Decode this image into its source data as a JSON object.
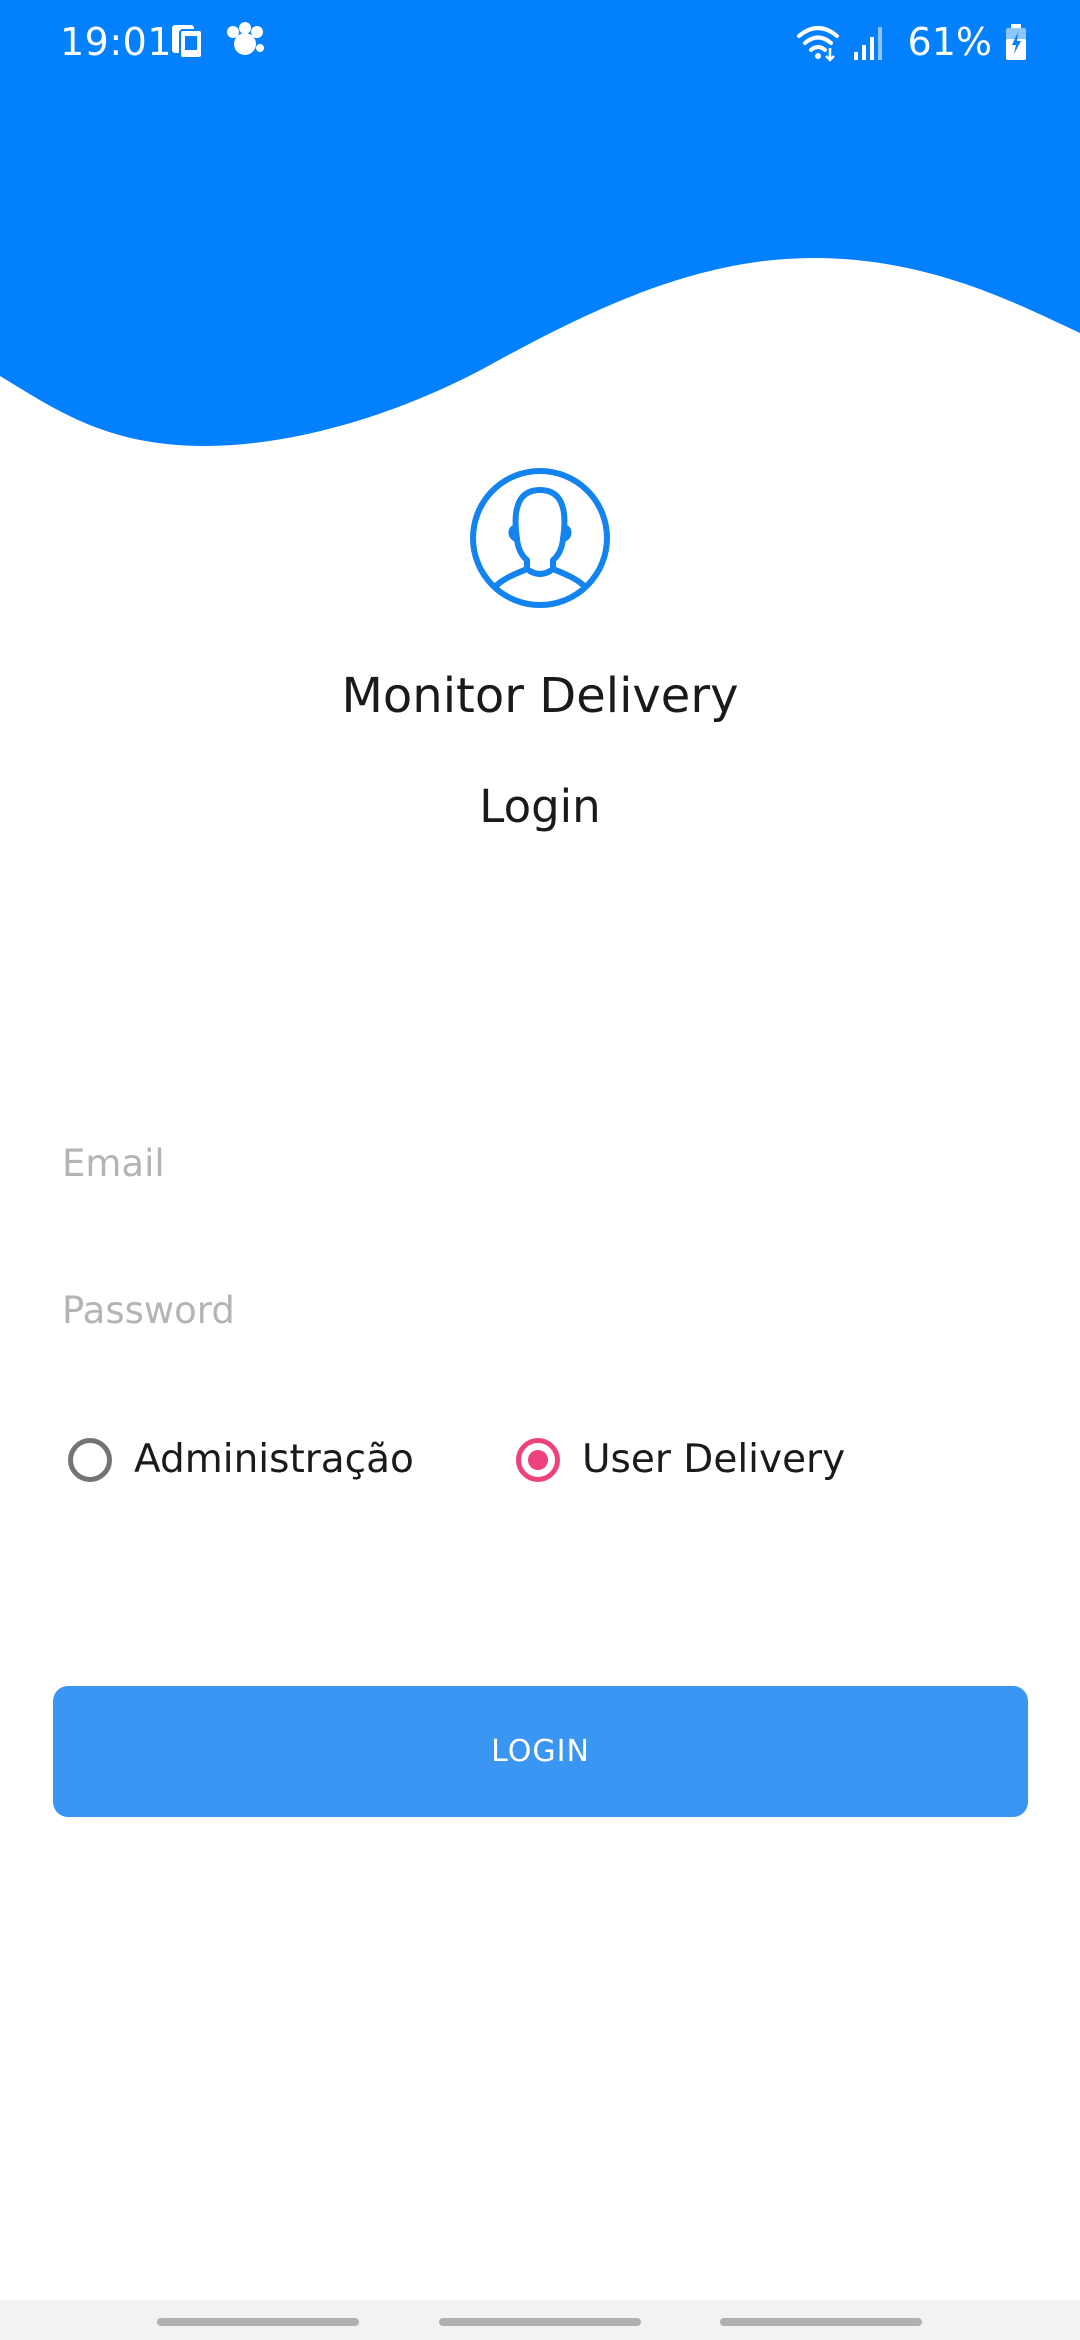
{
  "colors": {
    "header_blue": "#0380fd",
    "button_blue": "#3a96f2",
    "radio_accent": "#ee4280",
    "placeholder_gray": "#b4b4b4"
  },
  "status_bar": {
    "time": "19:01",
    "battery": "61%",
    "icons": [
      "notification-phone-icon",
      "notification-paw-icon",
      "wifi-icon",
      "signal-icon",
      "battery-icon"
    ]
  },
  "header": {
    "avatar_icon": "user-profile-icon",
    "app_title": "Monitor Delivery",
    "screen_title": "Login"
  },
  "form": {
    "email": {
      "value": "",
      "placeholder": "Email"
    },
    "password": {
      "value": "",
      "placeholder": "Password"
    },
    "role_options": [
      {
        "label": "Administração",
        "checked": false
      },
      {
        "label": "User Delivery",
        "checked": true
      }
    ],
    "login_button_label": "LOGIN"
  }
}
